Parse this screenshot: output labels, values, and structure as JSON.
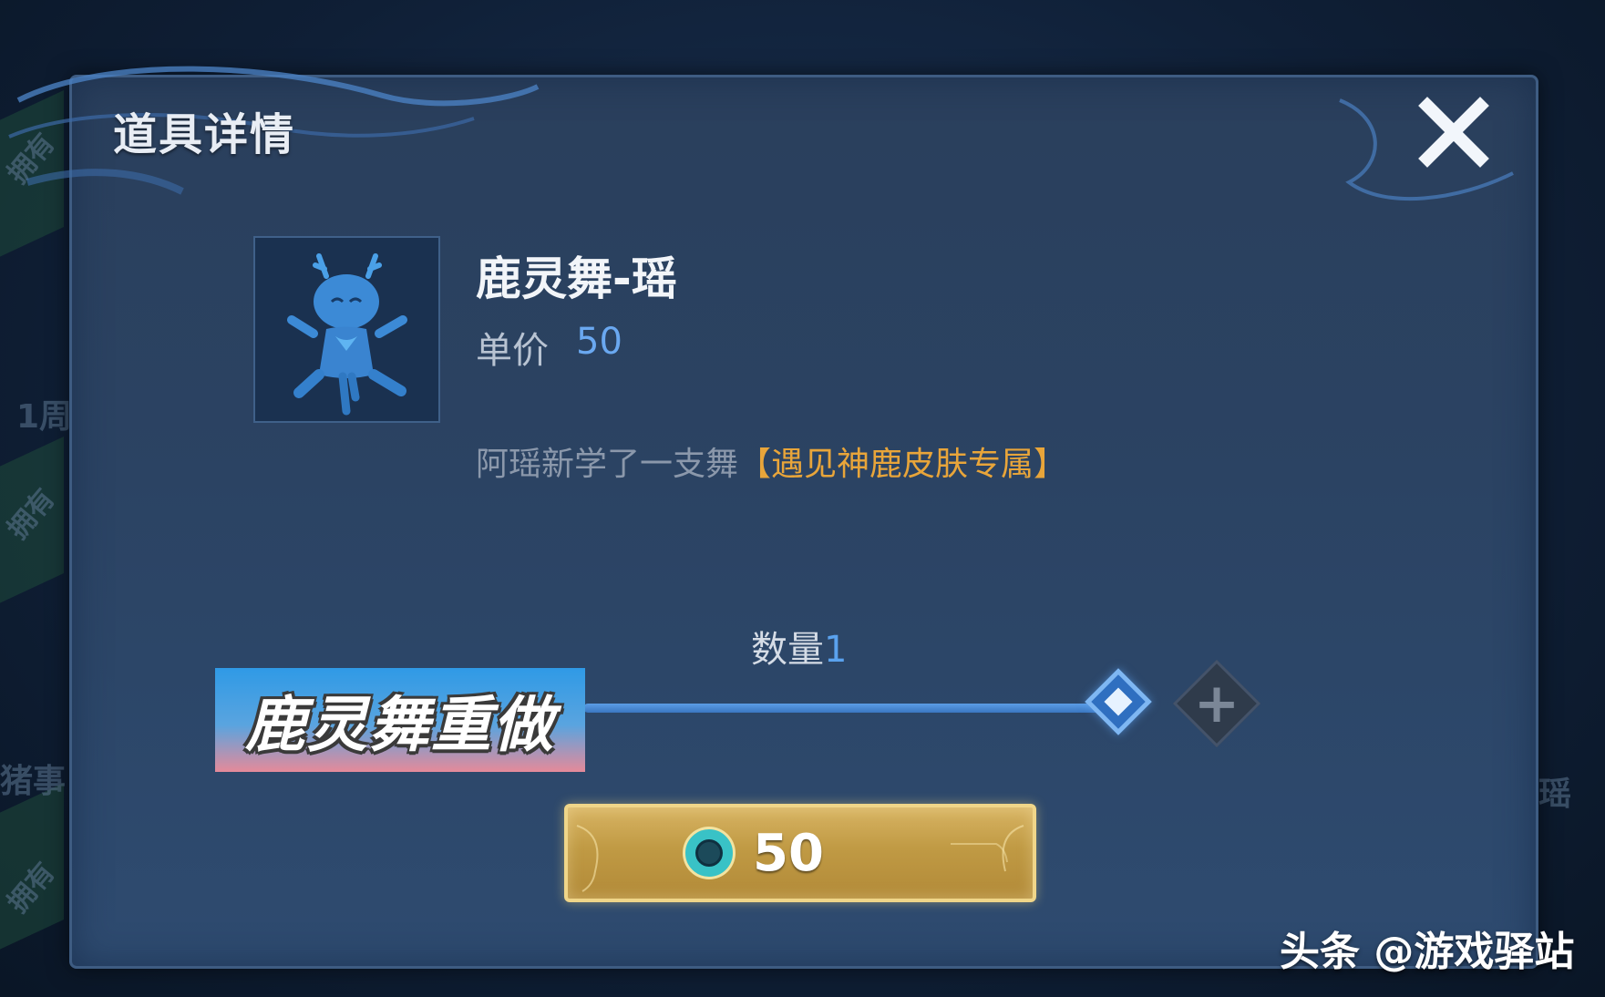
{
  "background": {
    "side_labels": [
      "拥有",
      "1周",
      "拥有",
      "猪事",
      "拥有",
      "瑶"
    ]
  },
  "dialog": {
    "title": "道具详情",
    "close_icon": "close-icon"
  },
  "item": {
    "name": "鹿灵舞-瑶",
    "price_label": "单价",
    "price_value": "50",
    "description": "阿瑶新学了一支舞",
    "description_tag": "【遇见神鹿皮肤专属】",
    "icon": "deer-dance-figure-icon"
  },
  "quantity": {
    "label": "数量",
    "value": "1",
    "plus_icon": "plus-icon"
  },
  "overlay": {
    "caption": "鹿灵舞重做"
  },
  "buy": {
    "price": "50",
    "currency_icon": "coupon-ring-icon"
  },
  "watermark": {
    "text": "头条 @游戏驿站"
  },
  "colors": {
    "accent_blue": "#5aa2ee",
    "tag_orange": "#e8a53a",
    "gold_button": "#c09a44"
  }
}
